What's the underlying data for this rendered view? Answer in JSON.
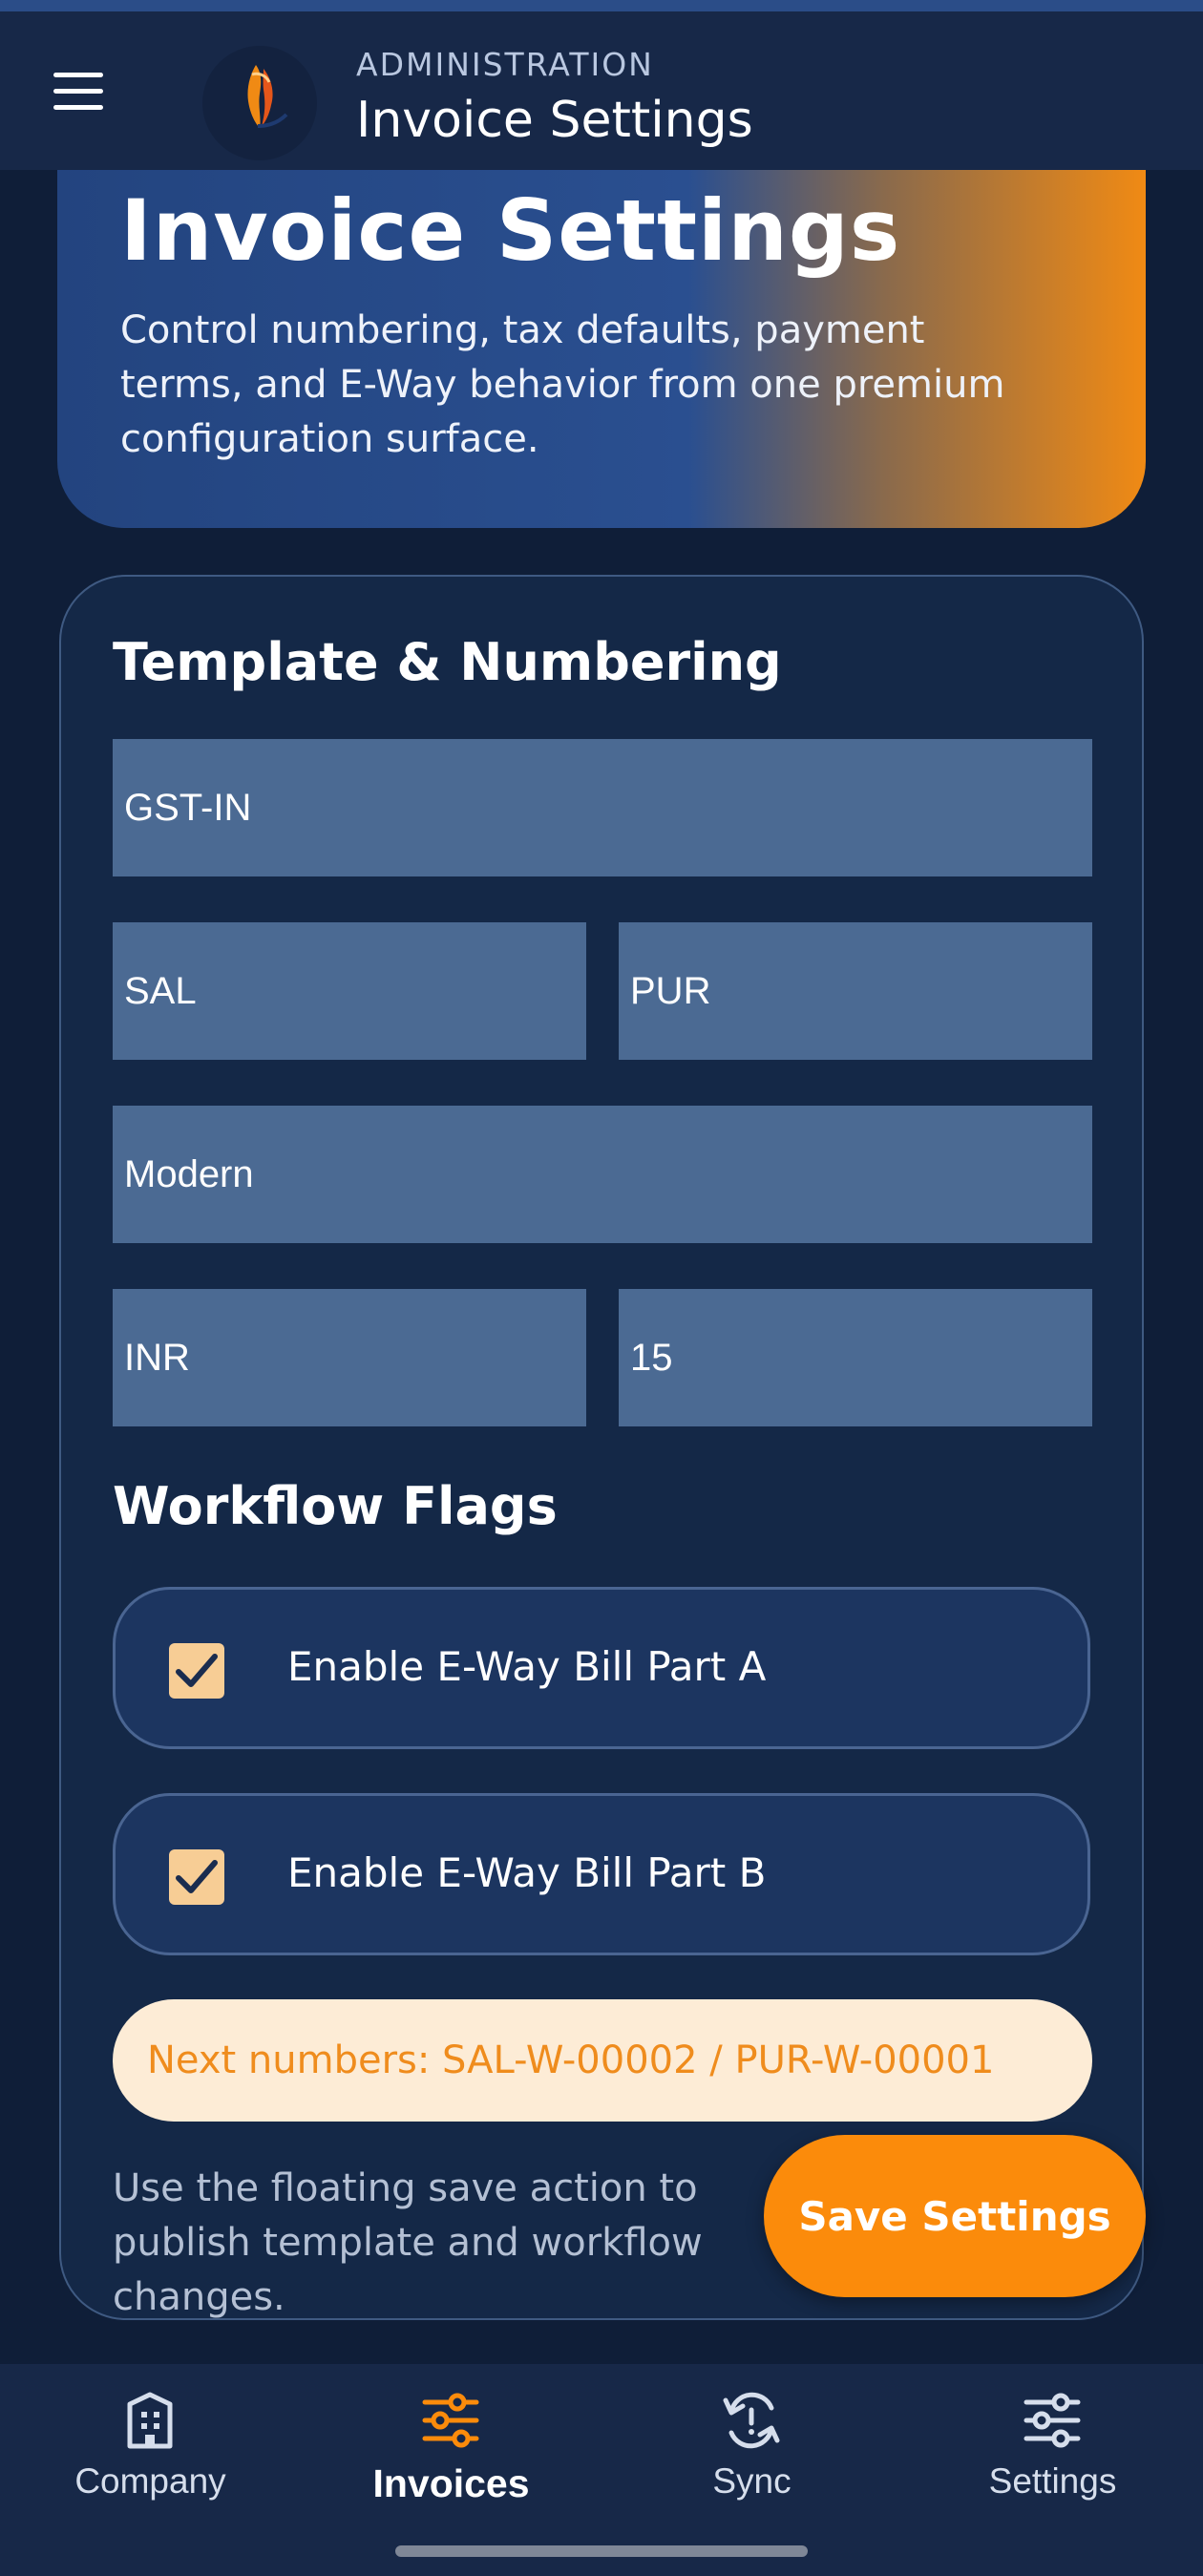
{
  "app_bar": {
    "overline": "ADMINISTRATION",
    "title": "Invoice Settings"
  },
  "hero": {
    "title": "Invoice Settings",
    "description": "Control numbering, tax defaults, payment terms, and E-Way behavior from one premium configuration surface."
  },
  "template_section": {
    "title": "Template & Numbering",
    "fields": {
      "template_code": "GST-IN",
      "sales_prefix": "SAL",
      "purchase_prefix": "PUR",
      "layout_style": "Modern",
      "currency": "INR",
      "payment_days": "15"
    }
  },
  "workflow_section": {
    "title": "Workflow Flags",
    "flags": [
      {
        "label": "Enable E-Way Bill Part A",
        "checked": true
      },
      {
        "label": "Enable E-Way Bill Part B",
        "checked": true
      }
    ]
  },
  "next_numbers": "Next numbers: SAL-W-00002 / PUR-W-00001",
  "footnote": "Use the floating save action to publish template and workflow changes.",
  "save_button": "Save Settings",
  "bottom_nav": [
    {
      "label": "Company",
      "icon": "building-icon",
      "active": false
    },
    {
      "label": "Invoices",
      "icon": "sliders-icon",
      "active": true
    },
    {
      "label": "Sync",
      "icon": "sync-icon",
      "active": false
    },
    {
      "label": "Settings",
      "icon": "settings-sliders-icon",
      "active": false
    }
  ],
  "colors": {
    "accent": "#fb8b0b",
    "background": "#0f1e38",
    "card": "#142847",
    "field": "#4b6a93",
    "checkbox": "#f7cd95",
    "next_numbers_bg": "#fdecd6"
  }
}
